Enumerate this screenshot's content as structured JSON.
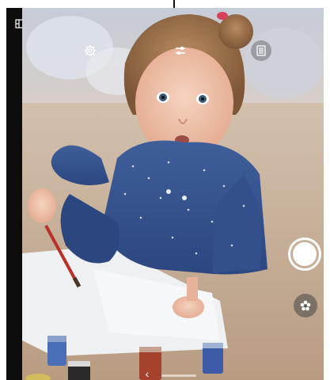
{
  "status_bar": {
    "title_text": ""
  },
  "icons": {
    "layout": "layout-panels-icon",
    "settings": "gear-icon",
    "adjust": "sliders-adjust-icon",
    "aspect": "aspect-ratio-icon",
    "shutter": "shutter-button",
    "effects": "flower-effects-icon",
    "back": "chevron-left-icon"
  },
  "bottom_nav": {
    "back_glyph": "‹",
    "mode_text": ""
  },
  "colors": {
    "frame": "#0d0d0d",
    "annotation": "#111111",
    "shutter": "#ffffff"
  }
}
